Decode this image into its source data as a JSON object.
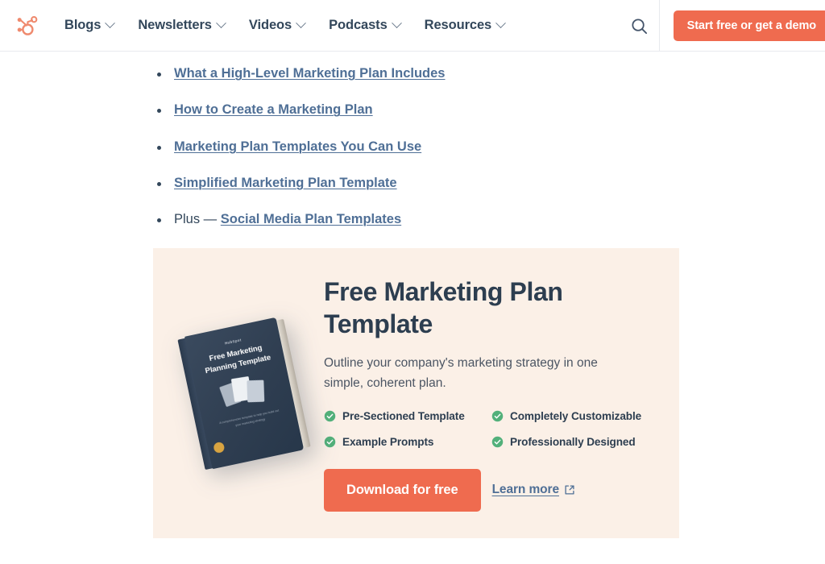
{
  "header": {
    "logo_icon": "hubspot-sprocket-logo",
    "nav_items": [
      {
        "label": "Blogs",
        "caret_icon": "chevron-down-icon"
      },
      {
        "label": "Newsletters",
        "caret_icon": "chevron-down-icon"
      },
      {
        "label": "Videos",
        "caret_icon": "chevron-down-icon"
      },
      {
        "label": "Podcasts",
        "caret_icon": "chevron-down-icon"
      },
      {
        "label": "Resources",
        "caret_icon": "chevron-down-icon"
      }
    ],
    "search_icon": "search-icon",
    "cta_label": "Start free or get a demo",
    "cta_color": "#ef6b4f"
  },
  "toc": {
    "items": [
      {
        "prefix": "",
        "link": "What a High-Level Marketing Plan Includes"
      },
      {
        "prefix": "",
        "link": "How to Create a Marketing Plan"
      },
      {
        "prefix": "",
        "link": "Marketing Plan Templates You Can Use"
      },
      {
        "prefix": "",
        "link": "Simplified Marketing Plan Template"
      },
      {
        "prefix": "Plus — ",
        "link": "Social Media Plan Templates"
      }
    ],
    "link_color": "#4f6f96"
  },
  "cta_card": {
    "background": "#fbf0e7",
    "title": "Free Marketing Plan Template",
    "description": "Outline your company's marketing strategy in one simple, coherent plan.",
    "features": [
      {
        "icon": "check-circle-icon",
        "label": "Pre-Sectioned Template"
      },
      {
        "icon": "check-circle-icon",
        "label": "Completely Customizable"
      },
      {
        "icon": "check-circle-icon",
        "label": "Example Prompts"
      },
      {
        "icon": "check-circle-icon",
        "label": "Professionally Designed"
      }
    ],
    "check_color": "#52b07a",
    "download_label": "Download for free",
    "download_color": "#ef6b4f",
    "learn_more_label": "Learn more",
    "learn_more_icon": "external-link-icon",
    "book": {
      "brand": "HubSpot",
      "title": "Free Marketing Planning Template",
      "subtitle": "A comprehensive template to help you build out your marketing strategy",
      "cover_color": "#2f3e51"
    }
  }
}
